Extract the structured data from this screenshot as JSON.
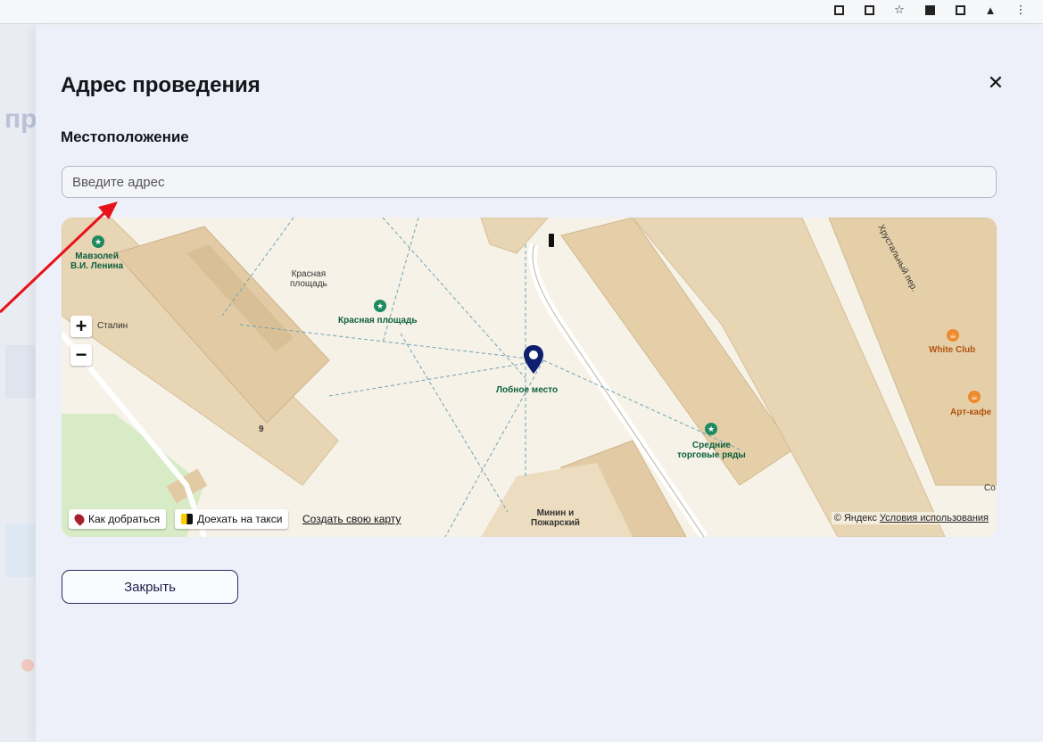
{
  "modal": {
    "title": "Адрес проведения",
    "close_icon": "✕",
    "location_label": "Местоположение",
    "address_placeholder": "Введите адрес",
    "close_button": "Закрыть"
  },
  "background_page": {
    "partial_text": "пр"
  },
  "map": {
    "labels": {
      "mausoleum": "Мавзолей\nВ.И. Ленина",
      "red_square_area": "Красная\nплощадь",
      "red_square_poi": "Красная площадь",
      "stalin": "Сталин",
      "lobnoe": "Лобное место",
      "trading_rows": "Средние\nторговые ряды",
      "white_club": "White Club",
      "art_cafe": "Арт-кафе",
      "minin": "Минин и\nПожарский",
      "hrustalny": "Хрустальный пер.",
      "building_number": "9",
      "edge_text": "Co"
    },
    "zoom_in": "+",
    "zoom_out": "−",
    "route_button": "Как добраться",
    "taxi_button": "Доехать на такси",
    "create_map_link": "Создать свою карту",
    "copyright": "© Яндекс",
    "terms_link": "Условия использования"
  },
  "colors": {
    "annotation_arrow": "#e8121a",
    "marker": "#0d1f6e",
    "poi_green": "#1e8a5f",
    "poi_orange": "#ef8a2b"
  }
}
